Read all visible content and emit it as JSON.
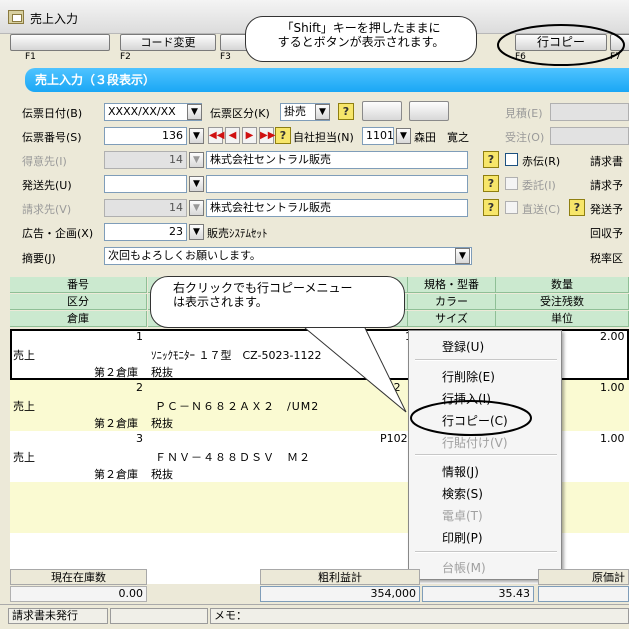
{
  "window": {
    "title": "売上入力"
  },
  "fkeys": [
    {
      "label": "F1",
      "button": ""
    },
    {
      "label": "F2",
      "button": "コード変更"
    },
    {
      "label": "F3",
      "button": ""
    },
    {
      "label": "F6",
      "button": "行コピー"
    },
    {
      "label": "F7",
      "button": ""
    }
  ],
  "callout_top": "「Shift」キーを押したままに\nするとボタンが表示されます。",
  "callout_mid": "右クリックでも行コピーメニュー\nは表示されます。",
  "banner": "売上入力（３段表示）",
  "form": {
    "denpyo_date_label": "伝票日付(B)",
    "denpyo_date_value": "XXXX/XX/XX",
    "denpyo_kubun_label": "伝票区分(K)",
    "denpyo_kubun_value": "掛売",
    "denpyo_no_label": "伝票番号(S)",
    "denpyo_no_value": "136",
    "tanto_label": "自社担当(N)",
    "tanto_code": "1101",
    "tanto_name": "森田　寛之",
    "tokui_label": "得意先(I)",
    "tokui_code": "14",
    "tokui_name": "株式会社セントラル販売",
    "akaden_label": "赤伝(R)",
    "seikyu_short": "請求書",
    "hasso_label": "発送先(U)",
    "hasso_code": "",
    "hasso_name": "",
    "itaku_label": "委託(I)",
    "seikyu_yotei_short": "請求予",
    "seikyu_label": "請求先(V)",
    "seikyu_code": "14",
    "seikyu_name": "株式会社セントラル販売",
    "chokuso_label": "直送(C)",
    "hasso_yotei_short": "発送予",
    "kokoku_label": "広告・企画(X)",
    "kokoku_code": "23",
    "kokoku_name": "販売ｼｽﾃﾑｾｯﾄ",
    "kaishu_short": "回収予",
    "tekiyo_label": "摘要(J)",
    "tekiyo_value": "次回もよろしくお願いします。",
    "zeiritsu_short": "税率区",
    "mitsumori_label": "見積(E)",
    "juchu_label": "受注(O)"
  },
  "grid_headers": {
    "row1": [
      "番号",
      "規格・型番",
      "数量"
    ],
    "row2": [
      "区分",
      "カラー",
      "受注残数"
    ],
    "row3": [
      "倉庫",
      "サイズ",
      "単位"
    ]
  },
  "rows": [
    {
      "no": "1",
      "kubun": "売上",
      "soko": "第２倉庫",
      "tax": "税抜",
      "item": "ｿﾆｯｸﾓﾆﾀｰ １７型　CZ-5023-1122",
      "code": "1",
      "qty": "2.00"
    },
    {
      "no": "2",
      "kubun": "売上",
      "soko": "第２倉庫",
      "tax": "税抜",
      "item": "ＰＣ－Ｎ６８２ＡＸ２　/UM2",
      "code": "P02",
      "qty": "1.00"
    },
    {
      "no": "3",
      "kubun": "売上",
      "soko": "第２倉庫",
      "tax": "税抜",
      "item": "ＦＮＶ－４８８ＤＳＶ　Ｍ２",
      "code": "P102",
      "qty": "1.00"
    }
  ],
  "context_menu": [
    {
      "label": "登録(U)",
      "enabled": true
    },
    {
      "label": "行削除(E)",
      "enabled": true
    },
    {
      "label": "行挿入(I)",
      "enabled": true
    },
    {
      "label": "行コピー(C)",
      "enabled": true
    },
    {
      "label": "行貼付け(V)",
      "enabled": false
    },
    {
      "label": "情報(J)",
      "enabled": true
    },
    {
      "label": "検索(S)",
      "enabled": true
    },
    {
      "label": "電卓(T)",
      "enabled": false
    },
    {
      "label": "印刷(P)",
      "enabled": true
    },
    {
      "label": "台帳(M)",
      "enabled": false
    }
  ],
  "footer": {
    "stock_label": "現在在庫数",
    "stock_value": "0.00",
    "profit_label": "粗利益計",
    "profit_value": "354,000",
    "profit_rate": "35.43",
    "cost_label": "原価計"
  },
  "status": {
    "panel1": "請求書未発行",
    "memo_label": "メモ："
  }
}
